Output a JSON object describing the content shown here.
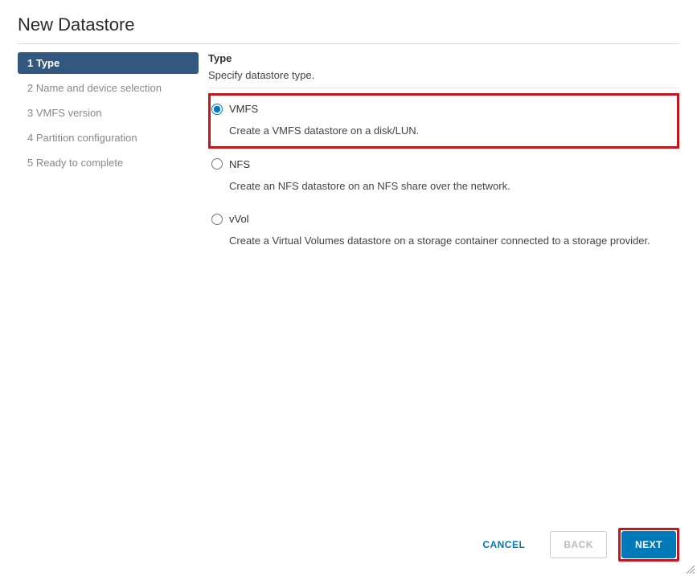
{
  "dialog": {
    "title": "New Datastore"
  },
  "wizard": {
    "steps": [
      {
        "label": "1 Type",
        "active": true
      },
      {
        "label": "2 Name and device selection",
        "active": false
      },
      {
        "label": "3 VMFS version",
        "active": false
      },
      {
        "label": "4 Partition configuration",
        "active": false
      },
      {
        "label": "5 Ready to complete",
        "active": false
      }
    ]
  },
  "main": {
    "heading": "Type",
    "subtext": "Specify datastore type.",
    "options": [
      {
        "value": "vmfs",
        "label": "VMFS",
        "description": "Create a VMFS datastore on a disk/LUN.",
        "selected": true,
        "highlighted": true
      },
      {
        "value": "nfs",
        "label": "NFS",
        "description": "Create an NFS datastore on an NFS share over the network.",
        "selected": false,
        "highlighted": false
      },
      {
        "value": "vvol",
        "label": "vVol",
        "description": "Create a Virtual Volumes datastore on a storage container connected to a storage provider.",
        "selected": false,
        "highlighted": false
      }
    ]
  },
  "footer": {
    "cancel": "CANCEL",
    "back": "BACK",
    "next": "NEXT",
    "next_highlighted": true
  }
}
